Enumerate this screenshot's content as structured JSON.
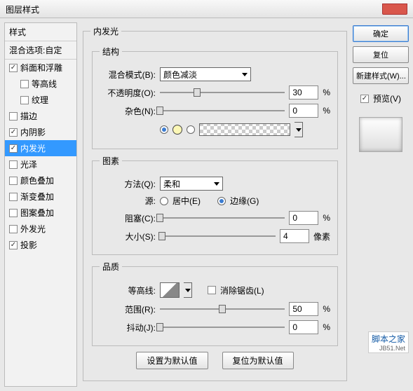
{
  "title": "图层样式",
  "sidebar": {
    "header": "样式",
    "subheader": "混合选项:自定",
    "items": [
      {
        "label": "斜面和浮雕",
        "checked": true,
        "indent": 0
      },
      {
        "label": "等高线",
        "checked": false,
        "indent": 1
      },
      {
        "label": "纹理",
        "checked": false,
        "indent": 1
      },
      {
        "label": "描边",
        "checked": false,
        "indent": 0
      },
      {
        "label": "内阴影",
        "checked": true,
        "indent": 0
      },
      {
        "label": "内发光",
        "checked": true,
        "indent": 0,
        "selected": true
      },
      {
        "label": "光泽",
        "checked": false,
        "indent": 0
      },
      {
        "label": "颜色叠加",
        "checked": false,
        "indent": 0
      },
      {
        "label": "渐变叠加",
        "checked": false,
        "indent": 0
      },
      {
        "label": "图案叠加",
        "checked": false,
        "indent": 0
      },
      {
        "label": "外发光",
        "checked": false,
        "indent": 0
      },
      {
        "label": "投影",
        "checked": true,
        "indent": 0
      }
    ]
  },
  "panel": {
    "title": "内发光",
    "groups": {
      "structure": {
        "legend": "结构",
        "blend_label": "混合模式(B):",
        "blend_value": "颜色减淡",
        "opacity_label": "不透明度(O):",
        "opacity_value": "30",
        "opacity_unit": "%",
        "noise_label": "杂色(N):",
        "noise_value": "0",
        "noise_unit": "%"
      },
      "elements": {
        "legend": "图素",
        "method_label": "方法(Q):",
        "method_value": "柔和",
        "source_label": "源:",
        "source_center": "居中(E)",
        "source_edge": "边缘(G)",
        "choke_label": "阻塞(C):",
        "choke_value": "0",
        "choke_unit": "%",
        "size_label": "大小(S):",
        "size_value": "4",
        "size_unit": "像素"
      },
      "quality": {
        "legend": "品质",
        "contour_label": "等高线:",
        "antialias_label": "消除锯齿(L)",
        "range_label": "范围(R):",
        "range_value": "50",
        "range_unit": "%",
        "jitter_label": "抖动(J):",
        "jitter_value": "0",
        "jitter_unit": "%"
      }
    },
    "footer": {
      "default": "设置为默认值",
      "reset": "复位为默认值"
    }
  },
  "right": {
    "ok": "确定",
    "cancel": "复位",
    "new_style": "新建样式(W)...",
    "preview_label": "预览(V)",
    "preview_checked": true
  },
  "watermark": {
    "line1": "脚本之家",
    "line2": "JB51.Net"
  }
}
